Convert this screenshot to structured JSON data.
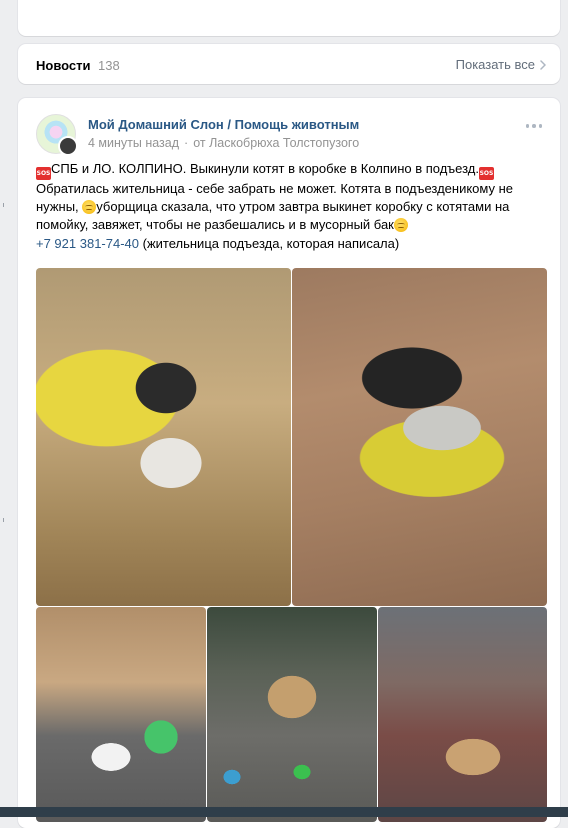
{
  "news": {
    "title": "Новости",
    "count": "138",
    "show_all": "Показать все"
  },
  "post": {
    "group_name": "Мой Домашний Слон / Помощь животным",
    "time": "4 минуты назад",
    "separator": "·",
    "from": "от Ласкобрюха Толстопузого",
    "text": {
      "l1_a": "СПБ и ЛО. КОЛПИНО. Выкинули котят в коробке в Колпино в подъезд.",
      "l2": "Обратилась жительница - себе забрать не может. Котята в подъезденикому не",
      "l3_a": "нужны, ",
      "l3_b": "уборщица сказала, что утром завтра выкинет коробку с котятами на",
      "l4_a": "помойку, завяжет, чтобы не разбешались и в мусорный бак",
      "l5_phone": "+7 921 381-74-40",
      "l5_rest": " (жительница подъезда, которая написала)"
    },
    "sos_label": "SOS",
    "photos": [
      "photo-kittens-box-yellow-blanket",
      "photo-kittens-in-box",
      "photo-kittens-near-box-green-bowl",
      "photo-kitten-box-floor",
      "photo-box-hallway"
    ]
  },
  "icons": {
    "more": "more-horizontal-icon",
    "chevron": "chevron-right-icon",
    "sos": "sos-emoji-icon",
    "face": "pensive-face-emoji-icon"
  },
  "colors": {
    "link": "#2a5885",
    "muted": "#939393",
    "sos": "#e3302f"
  }
}
